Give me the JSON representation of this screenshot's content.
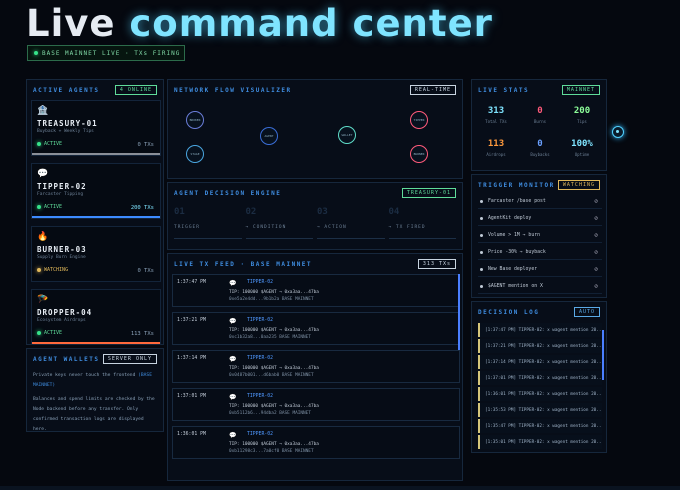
{
  "header": {
    "title_plain": "Live",
    "title_accent": "command center",
    "status": "BASE MAINNET LIVE · TXs FIRING"
  },
  "agents_panel": {
    "title": "ACTIVE AGENTS",
    "badge": "4 ONLINE",
    "agents": [
      {
        "icon": "bank-icon",
        "glyph": "🏦",
        "name": "TREASURY-01",
        "desc": "Buyback + Weekly Tips",
        "status": "ACTIVE",
        "txs": "0 TXs",
        "accent": "#8a8f98"
      },
      {
        "icon": "speech-bubble-icon",
        "glyph": "💬",
        "name": "TIPPER-02",
        "desc": "Farcaster Tipping",
        "status": "ACTIVE",
        "txs": "200 TXs",
        "accent": "#3d8bff"
      },
      {
        "icon": "fire-icon",
        "glyph": "🔥",
        "name": "BURNER-03",
        "desc": "Supply Burn Engine",
        "status": "WATCHING",
        "txs": "0 TXs",
        "accent": "#e0b85a"
      },
      {
        "icon": "parachute-icon",
        "glyph": "🪂",
        "name": "DROPPER-04",
        "desc": "Ecosystem Airdrops",
        "status": "ACTIVE",
        "txs": "113 TXs",
        "accent": "#ff6a3d"
      }
    ]
  },
  "wallets_panel": {
    "title": "AGENT WALLETS",
    "badge": "SERVER ONLY",
    "p1": "Private keys never touch the frontend",
    "p1_link": "(BASE MAINNET)",
    "p2": "Balances and spend limits are checked by the Node backend before any transfer. Only confirmed transaction logs are displayed here."
  },
  "network_panel": {
    "title": "NETWORK FLOW VISUALIZER",
    "badge": "REAL-TIME",
    "nodes": [
      "BROKER",
      "STAGE",
      "AGENT",
      "WALLET",
      "TIPPER",
      "BURNER"
    ]
  },
  "engine_panel": {
    "title": "AGENT DECISION ENGINE",
    "badge": "TREASURY-01",
    "steps": [
      {
        "num": "01",
        "label": "TRIGGER"
      },
      {
        "num": "02",
        "label": "→ CONDITION"
      },
      {
        "num": "03",
        "label": "→ ACTION"
      },
      {
        "num": "04",
        "label": "→ TX FIRED"
      }
    ]
  },
  "feed_panel": {
    "title": "LIVE TX FEED · BASE MAINNET",
    "badge": "313 TXs",
    "items": [
      {
        "time": "1:37:47 PM",
        "agent": "TIPPER-02",
        "line1": "TIP: 100000 $AGENT → 0xa3aa...47ba",
        "line2": "0xe5a2e4dd...9b1b2a  BASE MAINNET"
      },
      {
        "time": "1:37:21 PM",
        "agent": "TIPPER-02",
        "line1": "TIP: 100000 $AGENT → 0xa3aa...47ba",
        "line2": "0xc1b32a8...0aa235  BASE MAINNET"
      },
      {
        "time": "1:37:14 PM",
        "agent": "TIPPER-02",
        "line1": "TIP: 100000 $AGENT → 0xa3aa...47ba",
        "line2": "0x0487b001...d6bab0  BASE MAINNET"
      },
      {
        "time": "1:37:01 PM",
        "agent": "TIPPER-02",
        "line1": "TIP: 100000 $AGENT → 0xa3aa...47ba",
        "line2": "0xb5112b6...94dba2  BASE MAINNET"
      },
      {
        "time": "1:36:01 PM",
        "agent": "TIPPER-02",
        "line1": "TIP: 100000 $AGENT → 0xa3aa...47ba",
        "line2": "0xb11298c3...7a0cf0  BASE MAINNET"
      }
    ]
  },
  "stats_panel": {
    "title": "LIVE STATS",
    "badge": "MAINNET",
    "stats": [
      {
        "value": "313",
        "label": "Total TXs",
        "color": "#7fe4ff"
      },
      {
        "value": "0",
        "label": "Burns",
        "color": "#ff5a7a"
      },
      {
        "value": "200",
        "label": "Tips",
        "color": "#8dff9a"
      },
      {
        "value": "113",
        "label": "Airdrops",
        "color": "#ff9a3d"
      },
      {
        "value": "0",
        "label": "Buybacks",
        "color": "#6aa0ff"
      },
      {
        "value": "100%",
        "label": "Uptime",
        "color": "#7fe4ff"
      }
    ]
  },
  "trigger_panel": {
    "title": "TRIGGER MONITOR",
    "badge": "WATCHING",
    "items": [
      {
        "label": "Farcaster /base post",
        "state": "⊘"
      },
      {
        "label": "AgentKit deploy",
        "state": "⊘"
      },
      {
        "label": "Volume > 1M → burn",
        "state": "⊘"
      },
      {
        "label": "Price -30% → buyback",
        "state": "⊘"
      },
      {
        "label": "New Base deployer",
        "state": "⊘"
      },
      {
        "label": "$AGENT mention on X",
        "state": "⊘"
      }
    ]
  },
  "log_panel": {
    "title": "DECISION LOG",
    "badge": "AUTO",
    "items": [
      "[1:37:47 PM] TIPPER-02: x wagent mention 20...",
      "[1:37:21 PM] TIPPER-02: x wagent mention 20...",
      "[1:37:14 PM] TIPPER-02: x wagent mention 20...",
      "[1:37:01 PM] TIPPER-02: x wagent mention 20...",
      "[1:36:01 PM] TIPPER-02: x wagent mention 20...",
      "[1:35:53 PM] TIPPER-02: x wagent mention 20...",
      "[1:35:47 PM] TIPPER-02: x wagent mention 20...",
      "[1:35:01 PM] TIPPER-02: x wagent mention 20..."
    ]
  }
}
